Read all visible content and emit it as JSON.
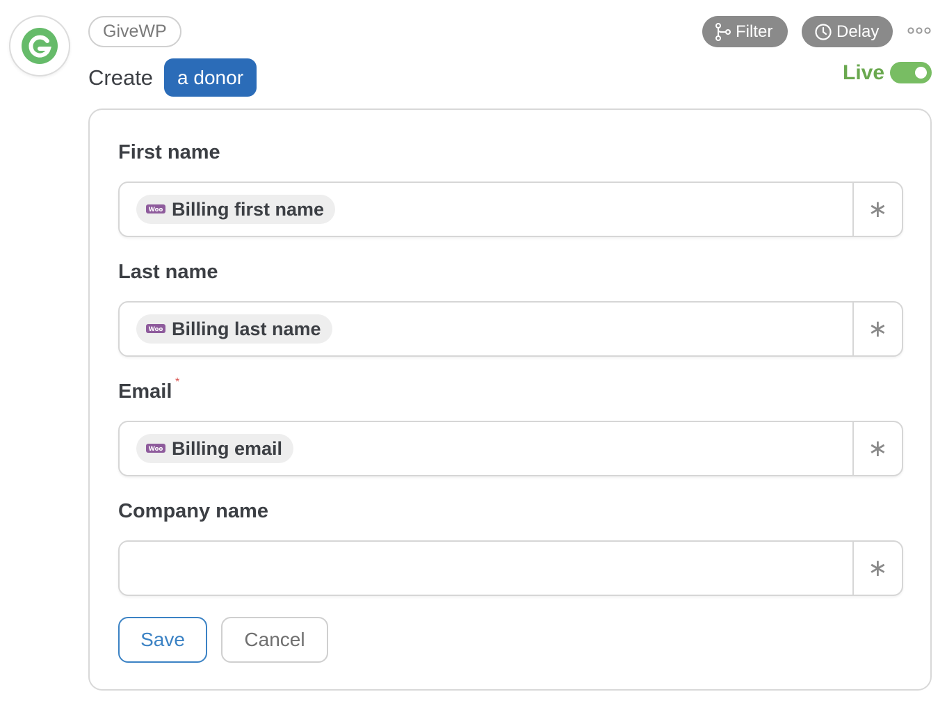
{
  "app": {
    "name": "GiveWP",
    "brand_color": "#66bb6a"
  },
  "action": {
    "verb": "Create",
    "object": "a donor"
  },
  "toolbar": {
    "filter_label": "Filter",
    "delay_label": "Delay",
    "more_icon": "more-icon",
    "live_label": "Live",
    "live_on": true
  },
  "form": {
    "fields": [
      {
        "label": "First name",
        "required": false,
        "token": "Billing first name",
        "token_source": "woo"
      },
      {
        "label": "Last name",
        "required": false,
        "token": "Billing last name",
        "token_source": "woo"
      },
      {
        "label": "Email",
        "required": true,
        "required_mark": "*",
        "token": "Billing email",
        "token_source": "woo"
      },
      {
        "label": "Company name",
        "required": false,
        "token": "",
        "token_source": ""
      }
    ],
    "insert_symbol": "∗",
    "save_label": "Save",
    "cancel_label": "Cancel"
  }
}
